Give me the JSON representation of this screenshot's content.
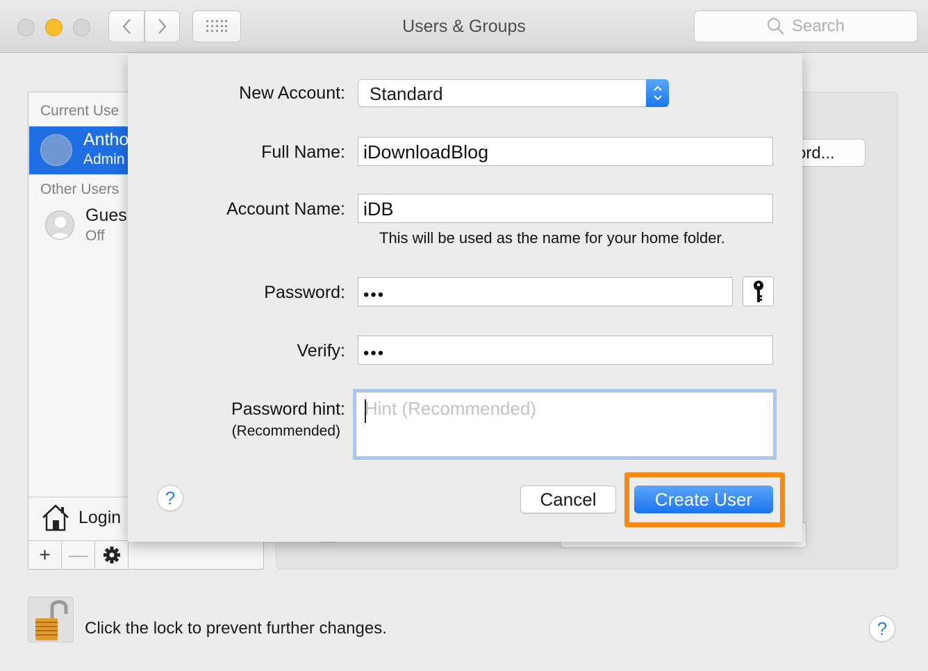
{
  "window": {
    "title": "Users & Groups",
    "search_placeholder": "Search"
  },
  "sidebar": {
    "current_header": "Current Use",
    "current_user": {
      "name": "Antho",
      "role": "Admin"
    },
    "other_header": "Other Users",
    "guest": {
      "name": "Gues",
      "status": "Off"
    },
    "login_label": "Login",
    "add_label": "+",
    "remove_label": "—"
  },
  "background": {
    "password_button_fragment": "ord..."
  },
  "sheet": {
    "new_account_label": "New Account:",
    "new_account_value": "Standard",
    "full_name_label": "Full Name:",
    "full_name_value": "iDownloadBlog",
    "account_name_label": "Account Name:",
    "account_name_value": "iDB",
    "account_name_note": "This will be used as the name for your home folder.",
    "password_label": "Password:",
    "password_value": "•••",
    "verify_label": "Verify:",
    "verify_value": "•••",
    "hint_label": "Password hint:",
    "hint_label_sub": "(Recommended)",
    "hint_placeholder": "Hint (Recommended)",
    "help_label": "?",
    "cancel_label": "Cancel",
    "create_label": "Create User",
    "highlight_color": "#f88a14"
  },
  "footer": {
    "lock_text": "Click the lock to prevent further changes.",
    "help_label": "?"
  }
}
